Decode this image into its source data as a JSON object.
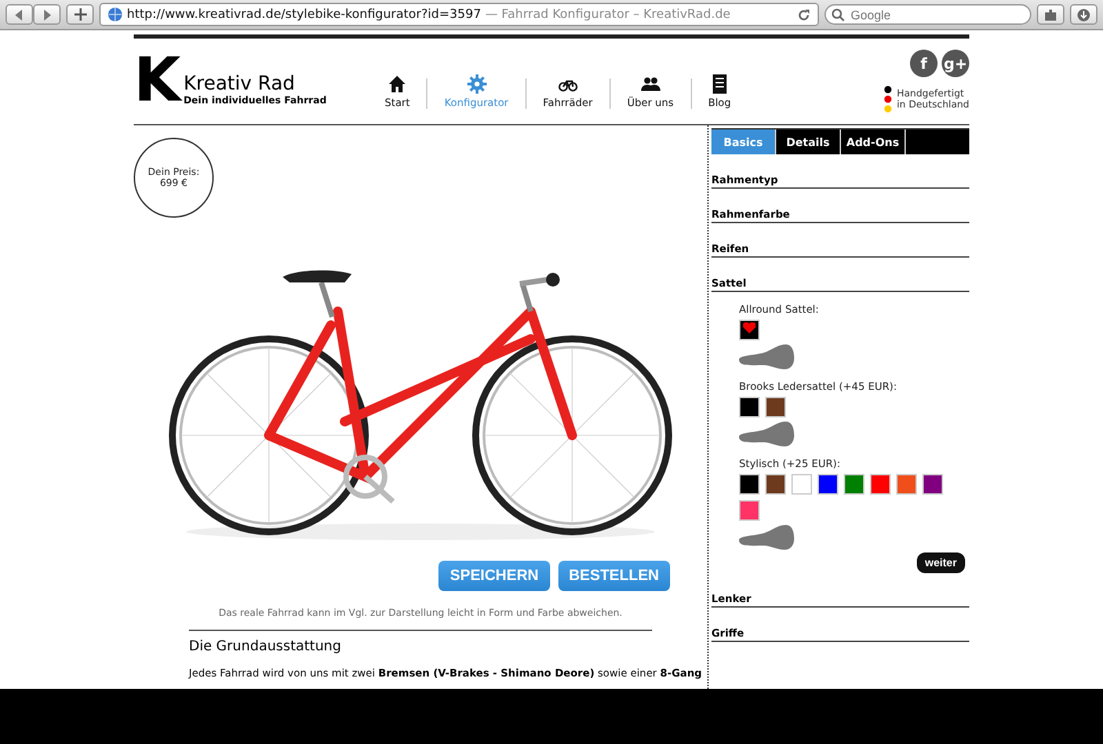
{
  "browser": {
    "url": "http://www.kreativrad.de/stylebike-konfigurator?id=3597",
    "page_title": "— Fahrrad Konfigurator – KreativRad.de",
    "search_placeholder": "Google"
  },
  "logo": {
    "letter": "K",
    "name": "Kreativ Rad",
    "tagline": "Dein individuelles Fahrrad"
  },
  "nav": [
    {
      "label": "Start",
      "selected": false
    },
    {
      "label": "Konfigurator",
      "selected": true
    },
    {
      "label": "Fahrräder",
      "selected": false
    },
    {
      "label": "Über uns",
      "selected": false
    },
    {
      "label": "Blog",
      "selected": false
    }
  ],
  "social": [
    "f",
    "g+"
  ],
  "made_in": [
    "Handgefertigt",
    "in Deutschland"
  ],
  "price": {
    "label": "Dein Preis:",
    "value": "699 €"
  },
  "actions": [
    "SPEICHERN",
    "BESTELLEN"
  ],
  "disclaimer": "Das reale Fahrrad kann im Vgl. zur Darstellung leicht in Form und Farbe abweichen.",
  "equipment": {
    "heading": "Die Grundausstattung",
    "text": "Jedes Fahrrad wird von uns mit zwei **Bremsen (V-Brakes - Shimano Deore)** sowie einer **8-Gang**"
  },
  "tabs": [
    {
      "label": "Basics",
      "selected": true
    },
    {
      "label": "Details",
      "selected": false
    },
    {
      "label": "Add-Ons",
      "selected": false
    }
  ],
  "sections": [
    {
      "title": "Rahmentyp"
    },
    {
      "title": "Rahmenfarbe"
    },
    {
      "title": "Reifen"
    },
    {
      "title": "Sattel",
      "next": "weiter",
      "options": [
        {
          "label": "Allround Sattel:",
          "swatches": [
            {
              "color": "#000000",
              "selected": true
            }
          ]
        },
        {
          "label": "Brooks Ledersattel (+45 EUR):",
          "swatches": [
            {
              "color": "#000000",
              "selected": false
            },
            {
              "color": "#6e3a1e",
              "selected": false
            }
          ]
        },
        {
          "label": "Stylisch (+25 EUR):",
          "swatches": [
            {
              "color": "#000000",
              "selected": false
            },
            {
              "color": "#6e3a1e",
              "selected": false
            },
            {
              "color": "#ffffff",
              "selected": false
            },
            {
              "color": "#0000ff",
              "selected": false
            },
            {
              "color": "#008000",
              "selected": false
            },
            {
              "color": "#ff0000",
              "selected": false
            },
            {
              "color": "#f04e1a",
              "selected": false
            },
            {
              "color": "#800080",
              "selected": false
            },
            {
              "color": "#ff3366",
              "selected": false
            }
          ]
        }
      ]
    },
    {
      "title": "Lenker"
    },
    {
      "title": "Griffe"
    }
  ]
}
